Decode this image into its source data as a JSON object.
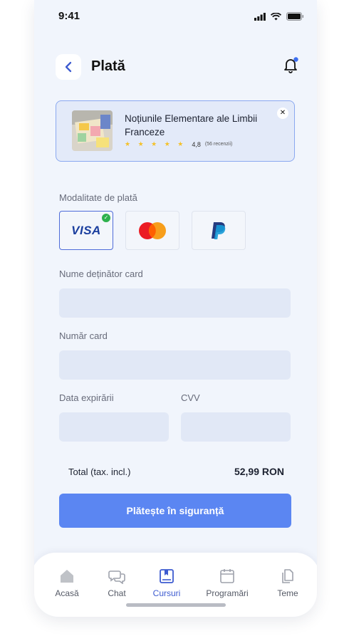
{
  "status_bar": {
    "time": "9:41"
  },
  "header": {
    "title": "Plată",
    "icons": {
      "back": "chevron-left-icon",
      "bell": "bell-icon"
    }
  },
  "course": {
    "title": "Noțiunile Elementare ale Limbii Franceze",
    "stars": "★ ★ ★ ★ ★",
    "rating": "4,8",
    "reviews": "(56 recenzii)"
  },
  "payment": {
    "section_label": "Modalitate de plată",
    "methods": [
      {
        "name": "VISA",
        "selected": true
      },
      {
        "name": "mastercard",
        "selected": false
      },
      {
        "name": "paypal",
        "selected": false
      }
    ],
    "check_mark": "✓"
  },
  "form": {
    "cardholder_label": "Nume deținător card",
    "card_number_label": "Număr card",
    "expiry_label": "Data expirării",
    "cvv_label": "CVV"
  },
  "summary": {
    "total_label": "Total (tax. incl.)",
    "total_value": "52,99 RON"
  },
  "pay_button": "Plătește în siguranță",
  "nav": {
    "items": [
      {
        "label": "Acasă",
        "icon": "home-icon",
        "active": false
      },
      {
        "label": "Chat",
        "icon": "chat-icon",
        "active": false
      },
      {
        "label": "Cursuri",
        "icon": "book-icon",
        "active": true
      },
      {
        "label": "Programări",
        "icon": "calendar-icon",
        "active": false
      },
      {
        "label": "Teme",
        "icon": "documents-icon",
        "active": false
      }
    ]
  },
  "colors": {
    "accent": "#5b86f2",
    "active_nav": "#3d5bd0",
    "check": "#2eb14d",
    "star": "#f4c12a"
  }
}
